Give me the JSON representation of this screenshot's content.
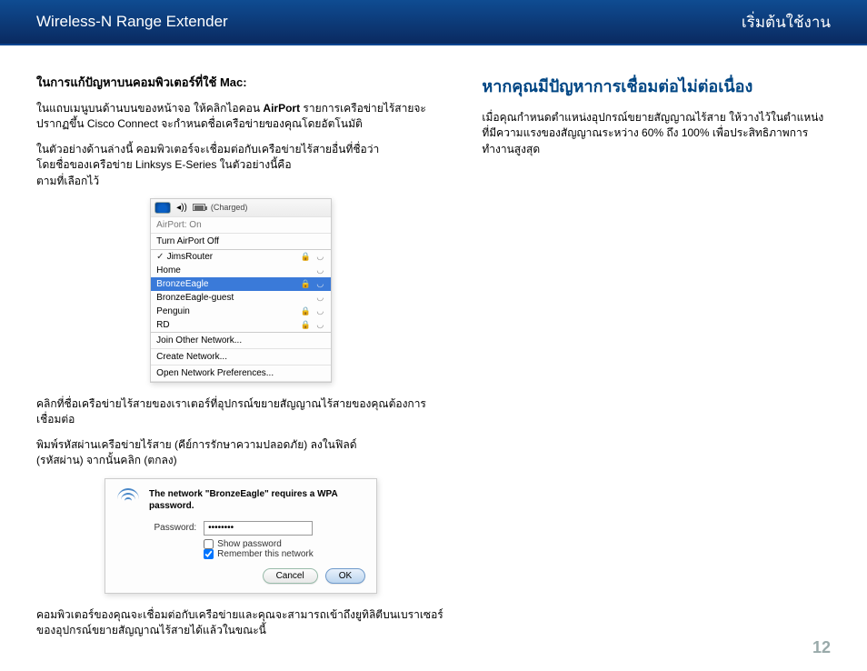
{
  "header": {
    "left": "Wireless-N Range Extender",
    "right": "เริ่มต้นใช้งาน"
  },
  "left": {
    "title_prefix": "ในการแก้ปัญหาบนคอมพิวเตอร์ที่ใช้",
    "title_mac": "Mac:",
    "p1a": "ในแถบเมนูบนด้านบนของหน้าจอ ให้คลิกไอคอน ",
    "p1b": "AirPort",
    "p1c": " รายการเครือข่ายไร้สายจะปรากฏขึ้น Cisco Connect จะกำหนดชื่อเครือข่ายของคุณโดยอัตโนมัติ",
    "p2a": "ในตัวอย่างด้านล่างนี้ คอมพิวเตอร์จะเชื่อมต่อกับเครือข่ายไร้สายอื่นที่ชื่อว่า ",
    "p2b": "             โดยชื่อของเครือข่าย Linksys E-Series ในตัวอย่างนี้คือ",
    "p2c": "                 ตามที่เลือกไว้",
    "p3": "คลิกที่ชื่อเครือข่ายไร้สายของเราเตอร์ที่อุปกรณ์ขยายสัญญาณไร้สายของคุณต้องการเชื่อมต่อ",
    "p4a": "พิมพ์รหัสผ่านเครือข่ายไร้สาย (คีย์การรักษาความปลอดภัย) ลงในฟิลด์",
    "p4b": "              (รหัสผ่าน) จากนั้นคลิก        (ตกลง)",
    "p5": "คอมพิวเตอร์ของคุณจะเชื่อมต่อกับเครือข่ายและคุณจะสามารถเข้าถึงยูทิลิตีบนเบราเซอร์ของอุปกรณ์ขยายสัญญาณไร้สายได้แล้วในขณะนี้"
  },
  "fig1": {
    "charged": "(Charged)",
    "airport_on": "AirPort: On",
    "turn_off": "Turn AirPort Off",
    "rows": [
      {
        "name": "JimsRouter",
        "check": true,
        "lock": true
      },
      {
        "name": "Home",
        "check": false,
        "lock": false
      },
      {
        "name": "BronzeEagle",
        "check": false,
        "lock": true,
        "selected": true
      },
      {
        "name": "BronzeEagle-guest",
        "check": false,
        "lock": false
      },
      {
        "name": "Penguin",
        "check": false,
        "lock": true
      },
      {
        "name": "RD",
        "check": false,
        "lock": true
      }
    ],
    "join": "Join Other Network...",
    "create": "Create Network...",
    "prefs": "Open Network Preferences..."
  },
  "fig2": {
    "msg": "The network \"BronzeEagle\" requires a WPA password.",
    "pw_label": "Password:",
    "pw_value": "••••••••",
    "show_pw": "Show password",
    "remember": "Remember this network",
    "cancel": "Cancel",
    "ok": "OK"
  },
  "right": {
    "heading": "หากคุณมีปัญหาการเชื่อมต่อไม่ต่อเนื่อง",
    "para": "เมื่อคุณกำหนดตำแหน่งอุปกรณ์ขยายสัญญาณไร้สาย ให้วางไว้ในตำแหน่งที่มีความแรงของสัญญาณระหว่าง 60% ถึง 100% เพื่อประสิทธิภาพการทำงานสูงสุด"
  },
  "page_number": "12"
}
